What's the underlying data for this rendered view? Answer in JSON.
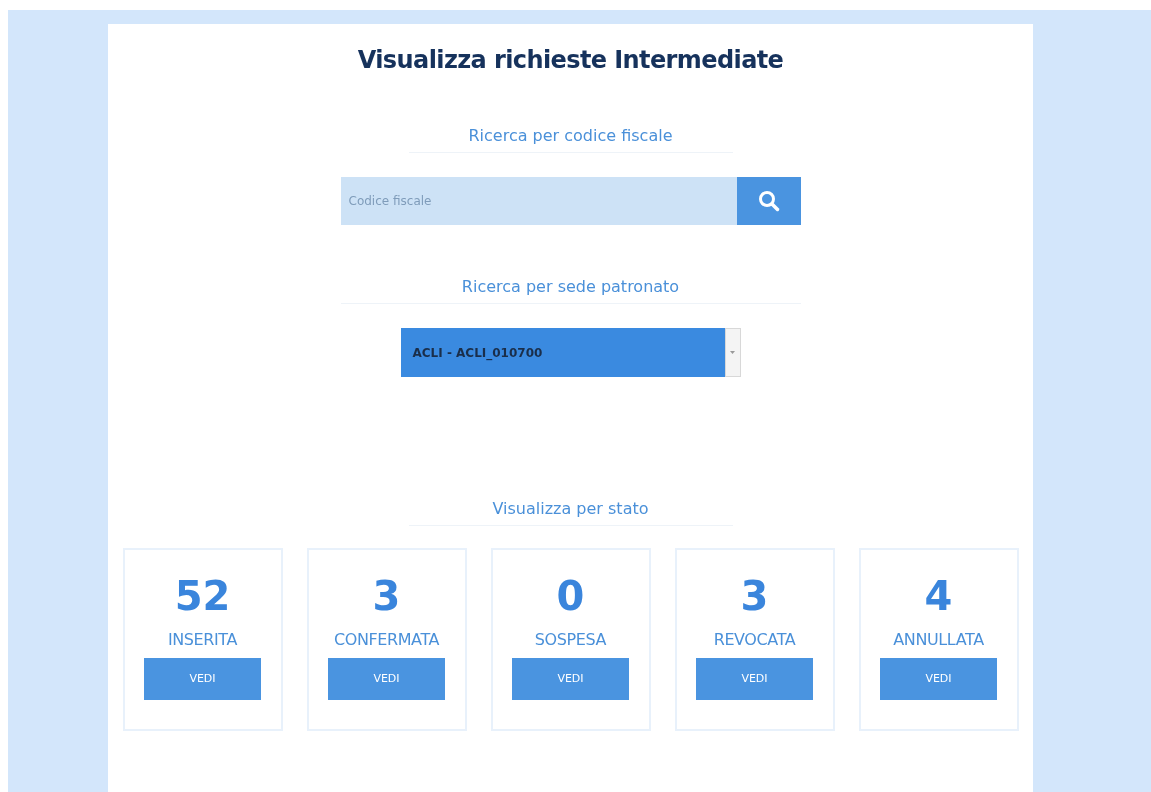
{
  "title": "Visualizza richieste Intermediate",
  "search_by_tax_code": {
    "heading": "Ricerca per codice fiscale",
    "placeholder": "Codice fiscale"
  },
  "search_by_office": {
    "heading": "Ricerca per sede patronato",
    "value": "ACLI - ACLI_010700"
  },
  "status_section": {
    "heading": "Visualizza per stato",
    "cards": [
      {
        "count": "52",
        "label": "INSERITA",
        "button": "VEDI"
      },
      {
        "count": "3",
        "label": "CONFERMATA",
        "button": "VEDI"
      },
      {
        "count": "0",
        "label": "SOSPESA",
        "button": "VEDI"
      },
      {
        "count": "3",
        "label": "REVOCATA",
        "button": "VEDI"
      },
      {
        "count": "4",
        "label": "ANNULLATA",
        "button": "VEDI"
      }
    ]
  }
}
